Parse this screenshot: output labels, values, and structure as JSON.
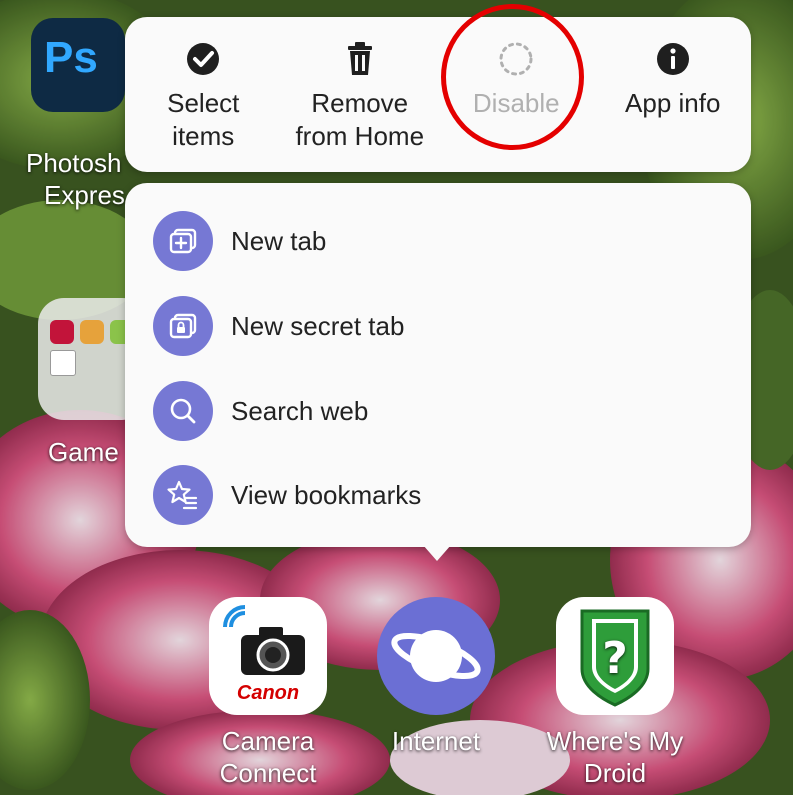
{
  "home": {
    "apps": {
      "photoshop": {
        "icon_text": "Ps",
        "label_line1": "Photosh",
        "label_line2": "Expres"
      },
      "games_folder": {
        "label": "Game"
      },
      "camera_connect": {
        "brand_text": "Canon",
        "label_line1": "Camera",
        "label_line2": "Connect"
      },
      "internet": {
        "label": "Internet"
      },
      "wheres_my_droid": {
        "label_line1": "Where's My",
        "label_line2": "Droid"
      }
    }
  },
  "context_menu": {
    "actions": [
      {
        "id": "select_items",
        "label": "Select\nitems",
        "icon": "check-circle-icon",
        "enabled": true
      },
      {
        "id": "remove_from_home",
        "label": "Remove\nfrom Home",
        "icon": "trash-icon",
        "enabled": true
      },
      {
        "id": "disable",
        "label": "Disable",
        "icon": "dotted-circle-icon",
        "enabled": false
      },
      {
        "id": "app_info",
        "label": "App info",
        "icon": "info-icon",
        "enabled": true
      }
    ],
    "shortcuts": [
      {
        "label": "New tab",
        "icon": "new-tab-icon"
      },
      {
        "label": "New secret tab",
        "icon": "secret-tab-icon"
      },
      {
        "label": "Search web",
        "icon": "search-icon"
      },
      {
        "label": "View bookmarks",
        "icon": "bookmarks-star-icon"
      }
    ]
  },
  "colors": {
    "highlight_ring": "#e40000",
    "shortcut_accent": "#7678d4",
    "menu_background": "#fafafa",
    "disabled_text": "#b0b0b0"
  }
}
